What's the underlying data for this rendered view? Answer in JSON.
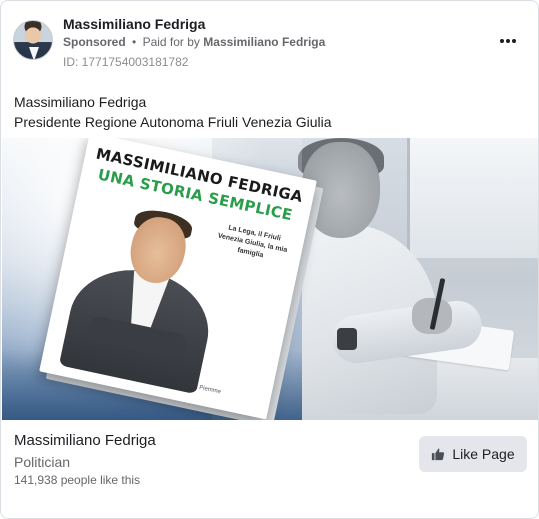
{
  "header": {
    "page_name": "Massimiliano Fedriga",
    "sponsored_label": "Sponsored",
    "separator": "•",
    "paid_for_text": "Paid for by",
    "payer": "Massimiliano Fedriga",
    "ad_id": "ID: 1771754003181782",
    "more_icon": "more-horizontal-icon"
  },
  "post": {
    "line1": "Massimiliano Fedriga",
    "line2": "Presidente Regione Autonoma Friuli Venezia Giulia"
  },
  "media": {
    "book_author": "MASSIMILIANO FEDRIGA",
    "book_title": "UNA STORIA SEMPLICE",
    "book_tagline": "La Lega, il Friuli Venezia Giulia, la mia famiglia",
    "book_publisher": "Piemme",
    "title_color": "#2a9d4a"
  },
  "footer": {
    "page_name": "Massimiliano Fedriga",
    "category": "Politician",
    "likes": "141,938 people like this",
    "like_button_label": "Like Page",
    "like_icon": "thumbs-up-icon"
  }
}
